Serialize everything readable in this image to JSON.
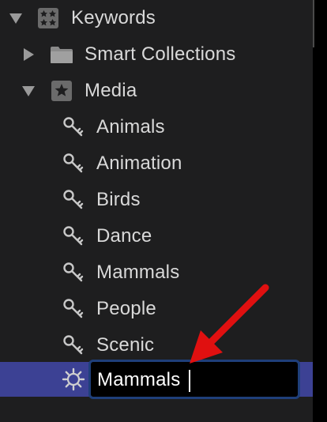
{
  "sidebar": {
    "keywords": {
      "label": "Keywords"
    },
    "smart_collections": {
      "label": "Smart Collections"
    },
    "media": {
      "label": "Media"
    },
    "keyword_items": [
      "Animals",
      "Animation",
      "Birds",
      "Dance",
      "Mammals",
      "People",
      "Scenic"
    ],
    "editing": {
      "value": "Mammals"
    }
  },
  "colors": {
    "background": "#1e1e1f",
    "selection": "#3c4194",
    "text": "#d9d9d9",
    "annotation_arrow": "#e01010"
  },
  "icons": {
    "keywords": "keyword-collection-icon",
    "smart_collections": "folder-icon",
    "media": "star-box-icon",
    "keyword": "key-icon",
    "editing": "gear-icon",
    "disclosure": "triangle-icon"
  }
}
